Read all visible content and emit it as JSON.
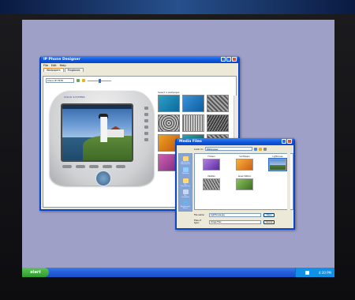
{
  "taskbar": {
    "start_label": "start",
    "clock": "4:30 PM"
  },
  "phone_designer": {
    "title": "IP Phone Designer",
    "menu": [
      "File",
      "Edit",
      "Help"
    ],
    "tabs": [
      "Wallpapers",
      "Ringtones"
    ],
    "model_select": "Cisco IP 7970",
    "panel_label": "Select a wallpaper",
    "phone_brand": "CISCO SYSTEMS",
    "apply_label": "Apply"
  },
  "media_files": {
    "title": "Media Files",
    "look_in_label": "Look in:",
    "look_in_value": "Wallpaper",
    "places": [
      "My Recent Documents",
      "Desktop",
      "My Documents",
      "My Computer",
      "My Network Places"
    ],
    "files": [
      {
        "name": "Flowers",
        "thumb": "f-purple"
      },
      {
        "name": "Sunflowers",
        "thumb": "f-orange"
      },
      {
        "name": "Lighthouse",
        "thumb": "f-light",
        "selected": true
      },
      {
        "name": "Pebbles",
        "thumb": "f-gray"
      },
      {
        "name": "Green Pattern",
        "thumb": "f-green"
      }
    ],
    "file_name_label": "File name:",
    "file_name_value": "Lighthouse.jpg",
    "file_type_label": "Files of type:",
    "file_type_value": "Image Files",
    "open_label": "Open",
    "cancel_label": "Cancel"
  },
  "colors": {
    "desktop": "#9fa0c8",
    "title_blue": "#0b55dc",
    "taskbar": "#245edb",
    "start_green": "#2f9a2c"
  }
}
